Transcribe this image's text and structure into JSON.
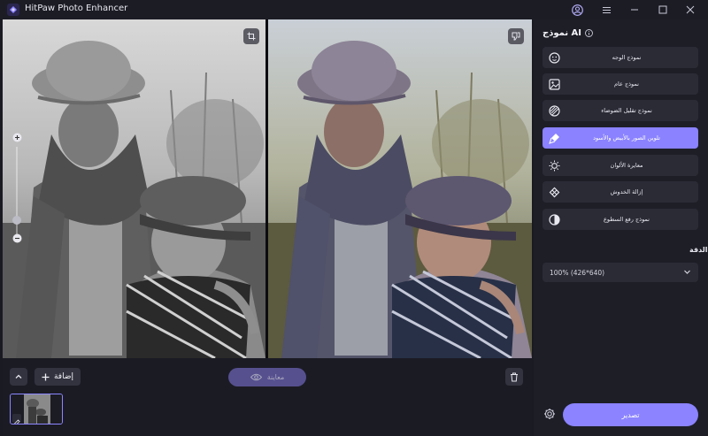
{
  "app": {
    "title": "HitPaw Photo Enhancer"
  },
  "toolbar": {
    "add_label": "إضافة",
    "preview_label": "معاينة"
  },
  "panel": {
    "title": "نموذج AI",
    "models": [
      {
        "label": "نموذج الوجه",
        "icon": "face-icon"
      },
      {
        "label": "نموذج عام",
        "icon": "image-icon"
      },
      {
        "label": "نموذج تقليل الضوضاء",
        "icon": "noise-icon"
      },
      {
        "label": "تلوين الصور بالأبيض والأسود",
        "icon": "brush-icon",
        "active": true
      },
      {
        "label": "معايرة الألوان",
        "icon": "sun-icon"
      },
      {
        "label": "إزالة الخدوش",
        "icon": "bandage-icon"
      },
      {
        "label": "نموذج رفع السطوع",
        "icon": "contrast-icon"
      }
    ],
    "resolution_label": "الدقة",
    "resolution_value": "100% (426*640)",
    "export_label": "تصدير"
  },
  "colors": {
    "accent": "#8b83ff",
    "background": "#1a1a23",
    "panel": "#1e1e27"
  }
}
